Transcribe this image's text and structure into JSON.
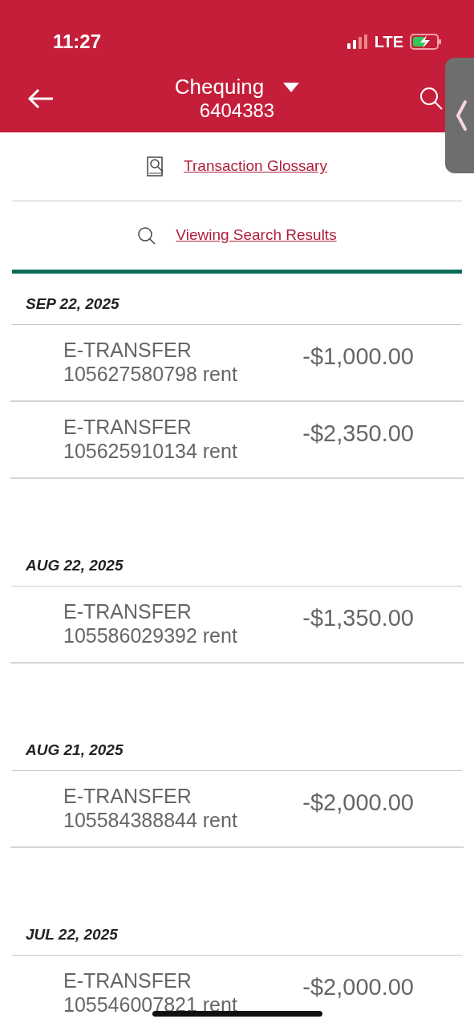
{
  "status_bar": {
    "time": "11:27",
    "network": "LTE"
  },
  "header": {
    "account_name": "Chequing",
    "account_number": "6404383"
  },
  "links": [
    {
      "kind": "glossary",
      "label": "Transaction Glossary"
    },
    {
      "kind": "search",
      "label": "Viewing Search Results"
    }
  ],
  "groups": [
    {
      "date": "SEP 22, 2025",
      "transactions": [
        {
          "title": "E-TRANSFER",
          "detail": "105627580798 rent",
          "amount": "-$1,000.00"
        },
        {
          "title": "E-TRANSFER",
          "detail": "105625910134 rent",
          "amount": "-$2,350.00"
        }
      ]
    },
    {
      "date": "AUG 22, 2025",
      "transactions": [
        {
          "title": "E-TRANSFER",
          "detail": "105586029392 rent",
          "amount": "-$1,350.00"
        }
      ]
    },
    {
      "date": "AUG 21, 2025",
      "transactions": [
        {
          "title": "E-TRANSFER",
          "detail": "105584388844 rent",
          "amount": "-$2,000.00"
        }
      ]
    },
    {
      "date": "JUL 22, 2025",
      "transactions": [
        {
          "title": "E-TRANSFER",
          "detail": "105546007821 rent",
          "amount": "-$2,000.00"
        }
      ]
    }
  ]
}
